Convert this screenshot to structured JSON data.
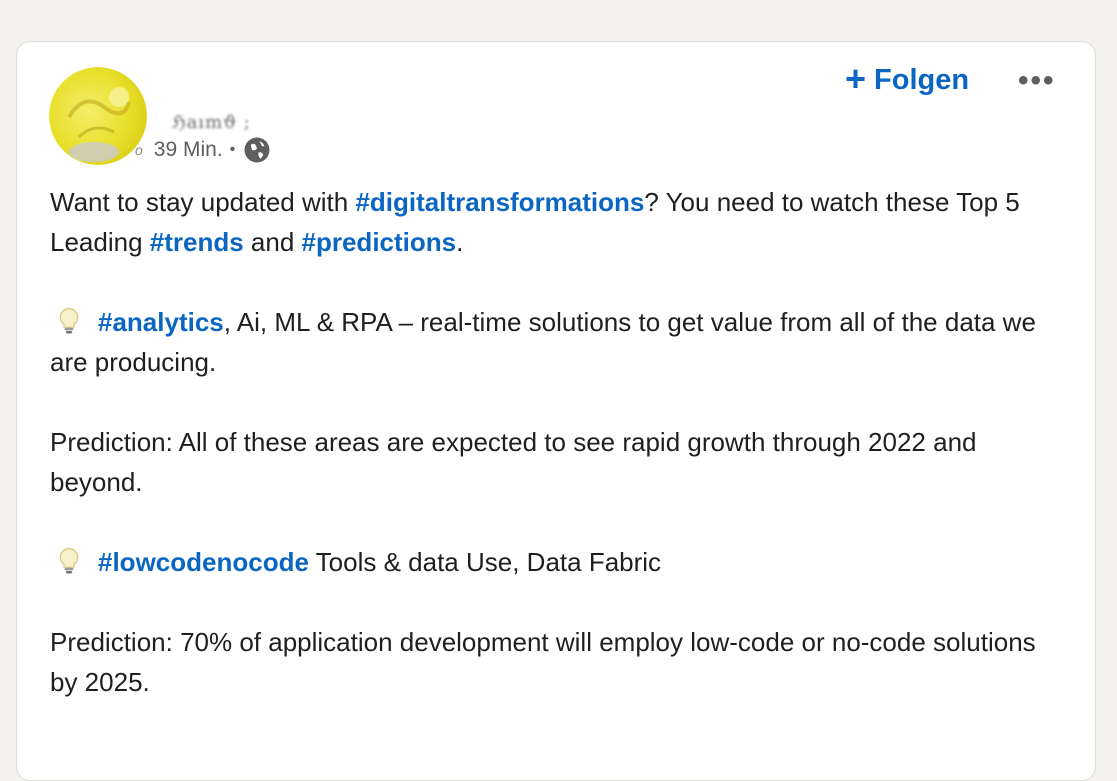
{
  "author": {
    "name": "ℌaımϑ ;",
    "time": "39 Min.",
    "edit_mark": "o",
    "separator": "•",
    "visibility_icon": "globe-icon"
  },
  "header": {
    "follow_label": "Folgen",
    "follow_icon": "plus-icon",
    "more_label": "•••"
  },
  "post": {
    "p1": {
      "t1": "Want to stay updated with ",
      "tag1": "#digitaltransformations",
      "t2": "? You need to watch these Top 5 Leading ",
      "tag2": "#trends",
      "t3": " and ",
      "tag3": "#predictions",
      "t4": "."
    },
    "p2": {
      "icon": "lightbulb-icon",
      "tag": "#analytics",
      "text": ", Ai, ML & RPA – real-time solutions to get value from all of the data we are producing."
    },
    "p3": "Prediction: All of these areas are expected to see rapid growth through 2022 and beyond.",
    "p4": {
      "icon": "lightbulb-icon",
      "tag": "#lowcodenocode",
      "text": " Tools & data Use, Data Fabric"
    },
    "p5": "Prediction: 70% of application development will employ low-code or no-code solutions by 2025."
  },
  "colors": {
    "link": "#0a66c2",
    "text": "#1f1f1f",
    "muted": "#5e5e5e",
    "page_bg": "#f4f2ee"
  }
}
